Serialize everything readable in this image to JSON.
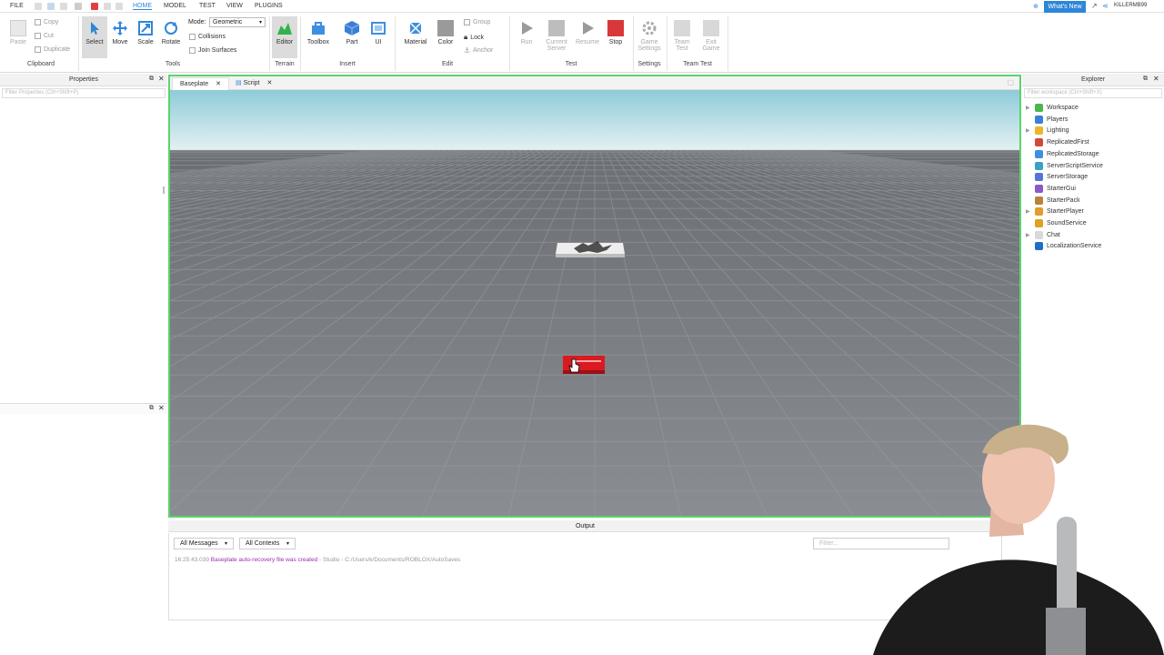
{
  "menus": [
    "FILE",
    "HOME",
    "MODEL",
    "TEST",
    "VIEW",
    "PLUGINS"
  ],
  "whats_new": "What's New",
  "user": "KILLERMB99",
  "ribbon": {
    "clipboard": {
      "paste": "Paste",
      "copy": "Copy",
      "cut": "Cut",
      "duplicate": "Duplicate",
      "label": "Clipboard"
    },
    "tools": {
      "select": "Select",
      "move": "Move",
      "scale": "Scale",
      "rotate": "Rotate",
      "mode_label": "Mode:",
      "mode_value": "Geometric",
      "collisions": "Collisions",
      "join_surfaces": "Join Surfaces",
      "label": "Tools"
    },
    "terrain": {
      "editor": "Editor",
      "label": "Terrain"
    },
    "insert": {
      "toolbox": "Toolbox",
      "part": "Part",
      "ui": "UI",
      "label": "Insert"
    },
    "edit": {
      "material": "Material",
      "color": "Color",
      "group": "Group",
      "lock": "Lock",
      "anchor": "Anchor",
      "label": "Edit"
    },
    "test": {
      "run": "Run",
      "current_server": "Current Server",
      "resume": "Resume",
      "stop": "Stop",
      "label": "Test"
    },
    "settings": {
      "game_settings": "Game Settings",
      "label": "Settings"
    },
    "team_test": {
      "team_test": "Team Test",
      "exit_game": "Exit Game",
      "label": "Team Test"
    }
  },
  "properties": {
    "title": "Properties",
    "filter_placeholder": "Filter Properties (Ctrl+Shift+P)"
  },
  "explorer": {
    "title": "Explorer",
    "filter_placeholder": "Filter workspace (Ctrl+Shift+X)",
    "items": [
      {
        "label": "Workspace",
        "icon": "workspace-icon",
        "color": "#49b749",
        "arrow": "▶"
      },
      {
        "label": "Players",
        "icon": "players-icon",
        "color": "#3a7fd5",
        "arrow": ""
      },
      {
        "label": "Lighting",
        "icon": "lighting-icon",
        "color": "#f0b429",
        "arrow": "▶"
      },
      {
        "label": "ReplicatedFirst",
        "icon": "replicated-first-icon",
        "color": "#d04a3a",
        "arrow": ""
      },
      {
        "label": "ReplicatedStorage",
        "icon": "replicated-storage-icon",
        "color": "#3f8fe0",
        "arrow": ""
      },
      {
        "label": "ServerScriptService",
        "icon": "server-script-service-icon",
        "color": "#3aa0c8",
        "arrow": ""
      },
      {
        "label": "ServerStorage",
        "icon": "server-storage-icon",
        "color": "#5576d8",
        "arrow": ""
      },
      {
        "label": "StarterGui",
        "icon": "starter-gui-icon",
        "color": "#8a58c8",
        "arrow": ""
      },
      {
        "label": "StarterPack",
        "icon": "starter-pack-icon",
        "color": "#b8823a",
        "arrow": ""
      },
      {
        "label": "StarterPlayer",
        "icon": "starter-player-icon",
        "color": "#e39b2a",
        "arrow": "▶"
      },
      {
        "label": "SoundService",
        "icon": "sound-service-icon",
        "color": "#e0a020",
        "arrow": ""
      },
      {
        "label": "Chat",
        "icon": "chat-icon",
        "color": "#d8d8d8",
        "arrow": "▶"
      },
      {
        "label": "LocalizationService",
        "icon": "localization-service-icon",
        "color": "#1f6fc8",
        "arrow": ""
      }
    ]
  },
  "tabs": [
    {
      "label": "Baseplate",
      "active": true
    },
    {
      "label": "Script",
      "active": false
    }
  ],
  "output": {
    "title": "Output",
    "messages_filter": "All Messages",
    "contexts_filter": "All Contexts",
    "filter_placeholder": "Filter...",
    "log_time": "16:25:43.039",
    "log_message": "Baseplate auto-recovery file was created",
    "log_detail": "- Studio - C:/Users/k/Documents/ROBLOX/AutoSaves"
  },
  "colors": {
    "accent": "#2f86d8",
    "viewport_border": "#5ad46c",
    "play": "#9a9a9a",
    "stop": "#d9383a",
    "spawn_part": "#d91a21"
  }
}
